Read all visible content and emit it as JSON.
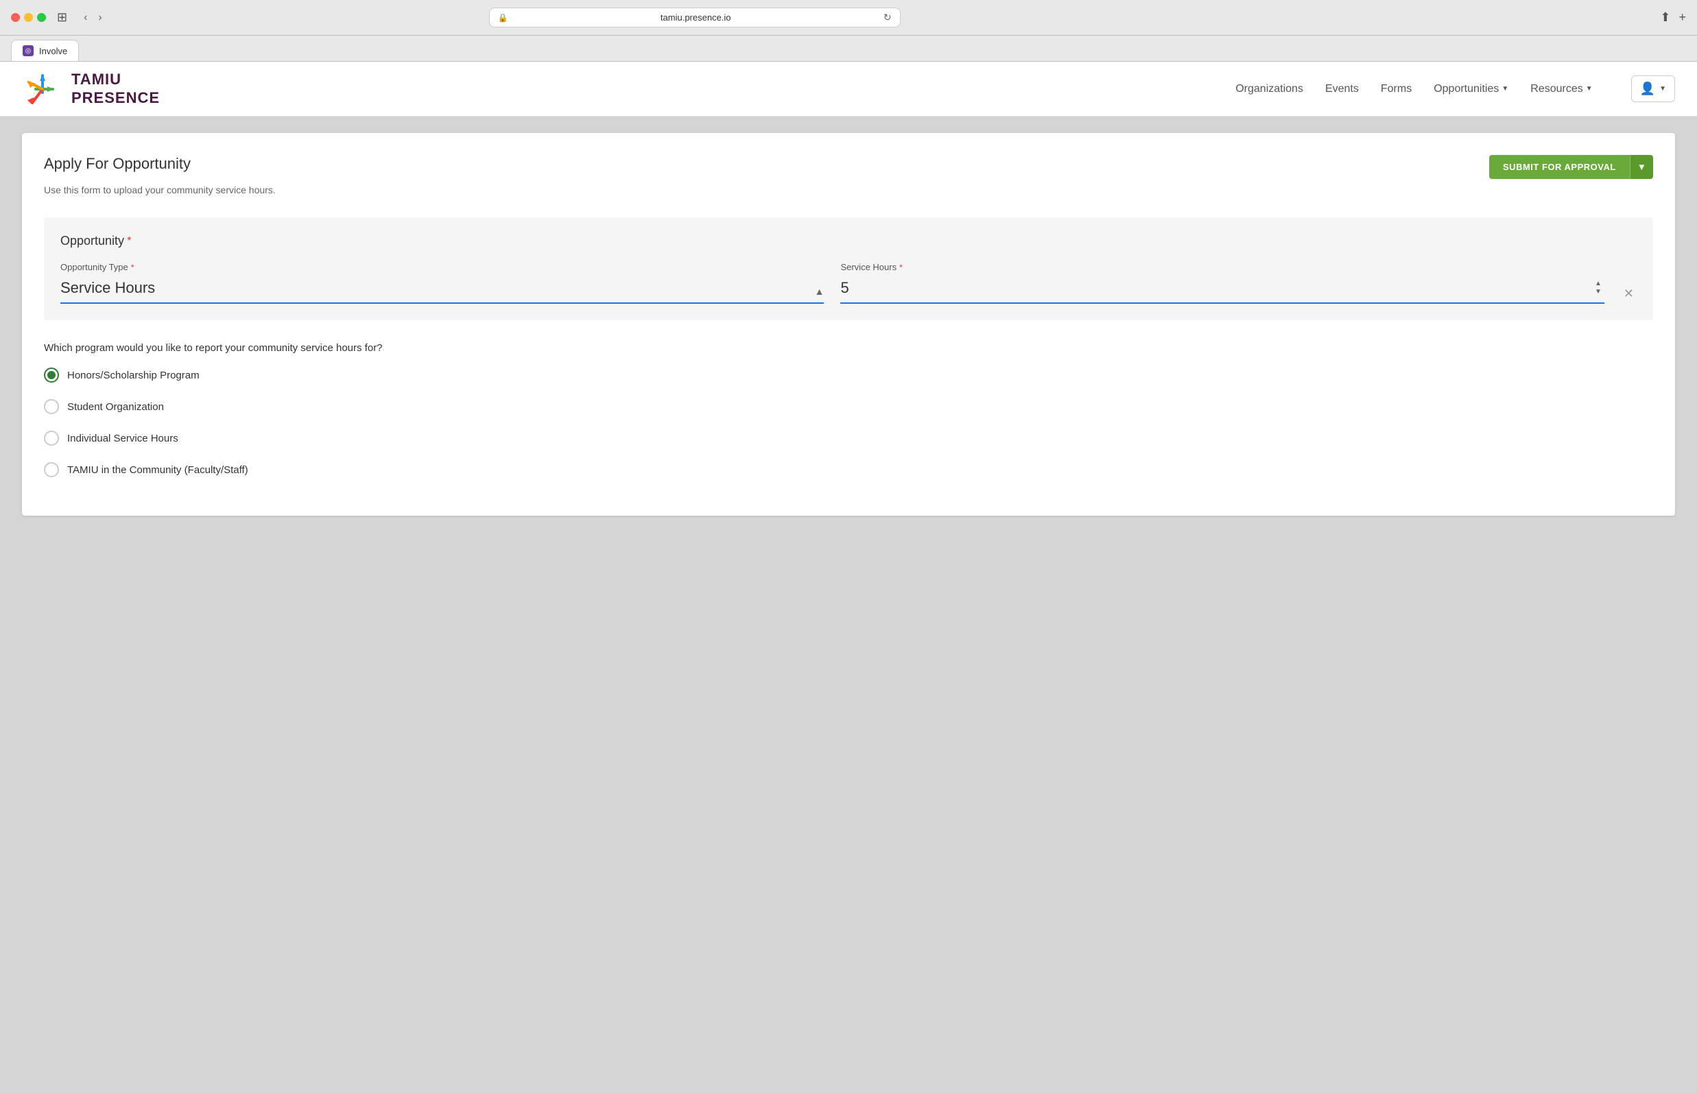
{
  "browser": {
    "url": "tamiu.presence.io",
    "tab_label": "Involve"
  },
  "navbar": {
    "logo_tamiu": "TAMIU",
    "logo_presence": "PRESENCE",
    "nav_organizations": "Organizations",
    "nav_events": "Events",
    "nav_forms": "Forms",
    "nav_opportunities": "Opportunities",
    "nav_resources": "Resources"
  },
  "form": {
    "title": "Apply For Opportunity",
    "subtitle": "Use this form to upload your community service hours.",
    "submit_label": "SUBMIT FOR APPROVAL",
    "opportunity_section_label": "Opportunity",
    "opportunity_type_label": "Opportunity Type",
    "opportunity_type_value": "Service Hours",
    "service_hours_label": "Service Hours",
    "service_hours_value": "5",
    "radio_question": "Which program would you like to report your community service hours for?",
    "radio_options": [
      {
        "id": "honors",
        "label": "Honors/Scholarship Program",
        "selected": true
      },
      {
        "id": "student-org",
        "label": "Student Organization",
        "selected": false
      },
      {
        "id": "individual",
        "label": "Individual Service Hours",
        "selected": false
      },
      {
        "id": "tamiu-community",
        "label": "TAMIU in the Community (Faculty/Staff)",
        "selected": false
      }
    ]
  }
}
